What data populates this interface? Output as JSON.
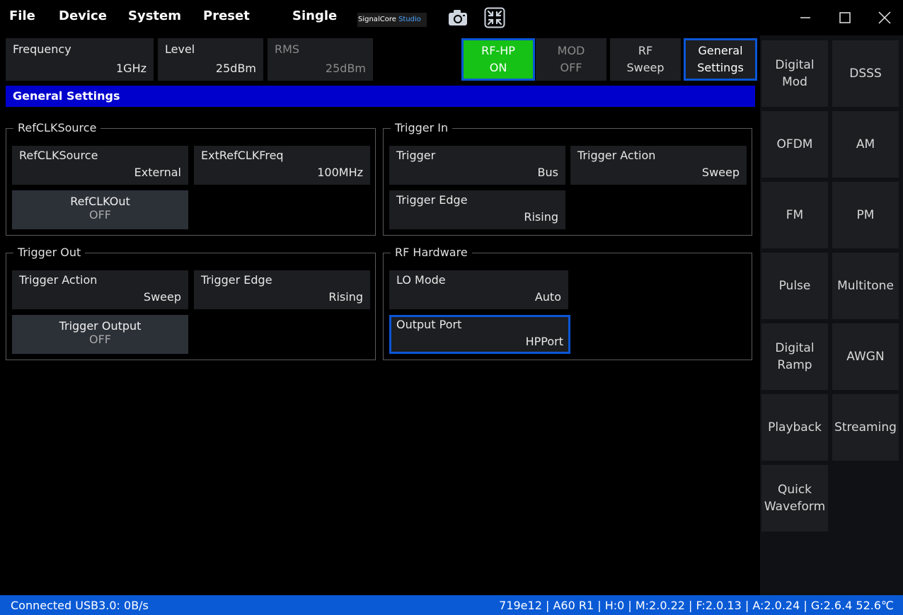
{
  "menu": [
    "File",
    "Device",
    "System",
    "Preset",
    "Single"
  ],
  "brand": {
    "name": "SignalCore",
    "suffix": "Studio"
  },
  "top_params": [
    {
      "label": "Frequency",
      "value": "1GHz"
    },
    {
      "label": "Level",
      "value": "25dBm"
    },
    {
      "label": "RMS",
      "value": "25dBm"
    }
  ],
  "toggles": [
    {
      "label": "RF-HP",
      "value": "ON"
    },
    {
      "label": "MOD",
      "value": "OFF"
    },
    {
      "label": "RF",
      "value": "Sweep"
    },
    {
      "label": "General",
      "value": "Settings"
    }
  ],
  "section_title": "General Settings",
  "groups": {
    "refclk": {
      "title": "RefCLKSource",
      "source": {
        "label": "RefCLKSource",
        "value": "External"
      },
      "freq": {
        "label": "ExtRefCLKFreq",
        "value": "100MHz"
      },
      "out": {
        "label": "RefCLKOut",
        "value": "OFF"
      }
    },
    "trigger_in": {
      "title": "Trigger In",
      "trigger": {
        "label": "Trigger",
        "value": "Bus"
      },
      "action": {
        "label": "Trigger Action",
        "value": "Sweep"
      },
      "edge": {
        "label": "Trigger Edge",
        "value": "Rising"
      }
    },
    "trigger_out": {
      "title": "Trigger Out",
      "action": {
        "label": "Trigger Action",
        "value": "Sweep"
      },
      "edge": {
        "label": "Trigger Edge",
        "value": "Rising"
      },
      "output": {
        "label": "Trigger Output",
        "value": "OFF"
      }
    },
    "rf_hw": {
      "title": "RF Hardware",
      "lo_mode": {
        "label": "LO Mode",
        "value": "Auto"
      },
      "output_port": {
        "label": "Output Port",
        "value": "HPPort"
      }
    }
  },
  "modulations": [
    {
      "line1": "Digital",
      "line2": "Mod"
    },
    {
      "line1": "DSSS",
      "line2": ""
    },
    {
      "line1": "OFDM",
      "line2": ""
    },
    {
      "line1": "AM",
      "line2": ""
    },
    {
      "line1": "FM",
      "line2": ""
    },
    {
      "line1": "PM",
      "line2": ""
    },
    {
      "line1": "Pulse",
      "line2": ""
    },
    {
      "line1": "Multitone",
      "line2": ""
    },
    {
      "line1": "Digital",
      "line2": "Ramp"
    },
    {
      "line1": "AWGN",
      "line2": ""
    },
    {
      "line1": "Playback",
      "line2": ""
    },
    {
      "line1": "Streaming",
      "line2": ""
    },
    {
      "line1": "Quick",
      "line2": "Waveform"
    }
  ],
  "status": {
    "left": "Connected USB3.0: 0B/s",
    "right": "719e12 | A60 R1 | H:0 | M:2.0.22 | F:2.0.13 | A:2.0.24 | G:2.6.4  52.6℃"
  },
  "colors": {
    "accent_blue": "#0b56d6",
    "on_green": "#16c216",
    "title_blue": "#0000cc"
  },
  "icons": [
    "camera-icon",
    "collapse-icon",
    "minimize-icon",
    "maximize-icon",
    "close-icon"
  ]
}
